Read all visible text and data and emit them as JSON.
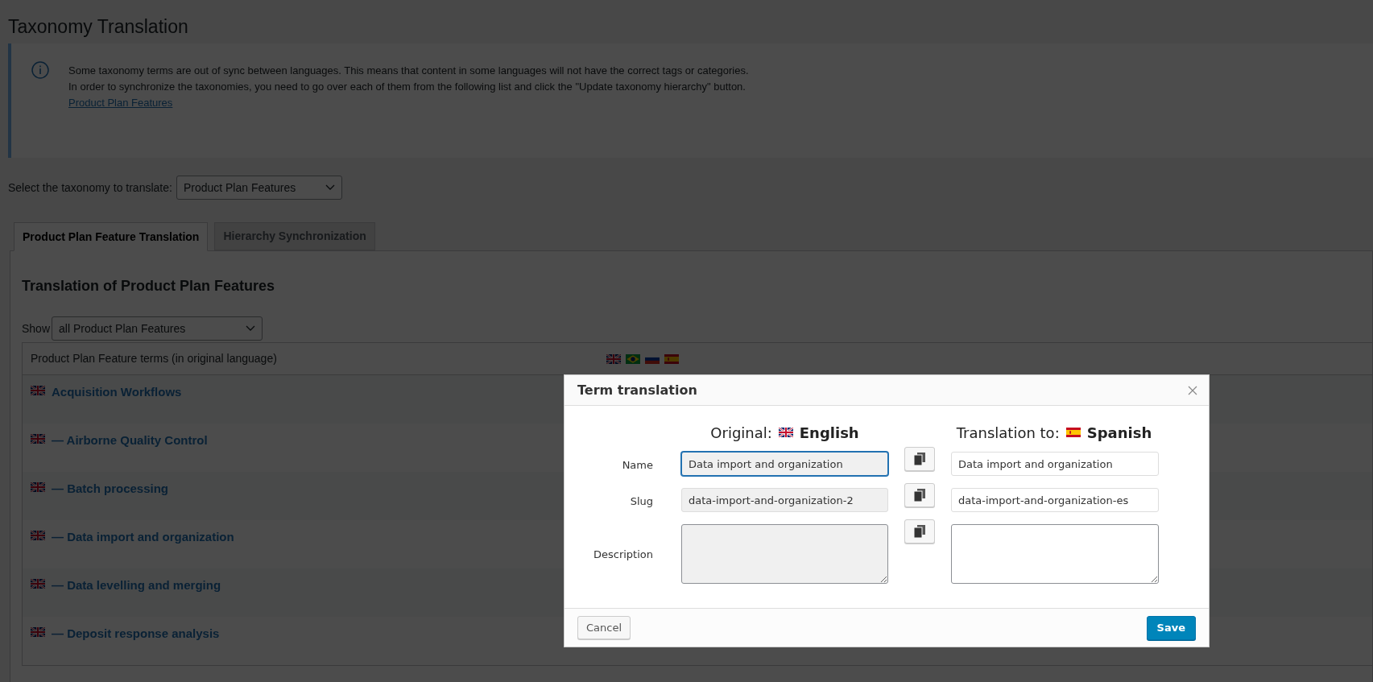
{
  "page_title": "Taxonomy Translation",
  "notice": {
    "lines": [
      "Some taxonomy terms are out of sync between languages. This means that content in some languages will not have the correct tags or categories.",
      "In order to synchronize the taxonomies, you need to go over each of them from the following list and click the \"Update taxonomy hierarchy\" button."
    ],
    "link": "Product Plan Features"
  },
  "taxonomy_select": {
    "label": "Select the taxonomy to translate:",
    "value": "Product Plan Features"
  },
  "tabs": [
    {
      "label": "Product Plan Feature Translation",
      "selected": true
    },
    {
      "label": "Hierarchy Synchronization",
      "selected": false
    }
  ],
  "section_title": "Translation of Product Plan Features",
  "show_filter": {
    "label": "Show",
    "value": "all Product Plan Features"
  },
  "table": {
    "header": "Product Plan Feature terms (in original language)",
    "header_flags": [
      {
        "kind": "gb"
      },
      {
        "kind": "br"
      },
      {
        "kind": "ru"
      },
      {
        "kind": "es"
      }
    ],
    "rows": [
      {
        "flag": {
          "kind": "gb"
        },
        "name": "Acquisition Workflows"
      },
      {
        "flag": {
          "kind": "gb"
        },
        "name": "— Airborne Quality Control"
      },
      {
        "flag": {
          "kind": "gb"
        },
        "name": "— Batch processing"
      },
      {
        "flag": {
          "kind": "gb"
        },
        "name": "— Data import and organization"
      },
      {
        "flag": {
          "kind": "gb"
        },
        "name": "— Data levelling and merging"
      },
      {
        "flag": {
          "kind": "gb"
        },
        "name": "— Deposit response analysis"
      }
    ]
  },
  "dialog": {
    "title": "Term translation",
    "original": {
      "label": "Original:",
      "flag": {
        "kind": "gb"
      },
      "language": "English"
    },
    "translation": {
      "label": "Translation to:",
      "flag": {
        "kind": "es"
      },
      "language": "Spanish"
    },
    "fields": [
      {
        "label": "Name",
        "kind": "input",
        "original": "Data import and organization",
        "translation": "Data import and organization",
        "focused": true
      },
      {
        "label": "Slug",
        "kind": "input",
        "original": "data-import-and-organization-2",
        "translation": "data-import-and-organization-es",
        "focused": false
      },
      {
        "label": "Description",
        "kind": "textarea",
        "focused": false
      }
    ],
    "cancel": "Cancel",
    "save": "Save"
  }
}
